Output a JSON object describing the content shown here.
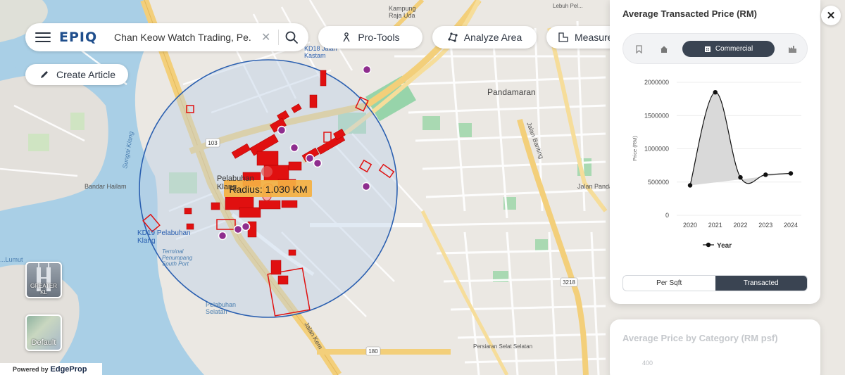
{
  "search": {
    "logo": "EPIQ",
    "query": "Chan Keow Watch Trading, Pe..."
  },
  "toolbar": {
    "protools_label": "Pro-Tools",
    "analyze_label": "Analyze Area",
    "measure_label": "Measure"
  },
  "create_article_label": "Create Article",
  "map": {
    "radius_label": "Radius: 1.030 KM",
    "labels": {
      "kampung_raja_uda": "Kampung\nRaja Uda",
      "lebuh_pelabuhan": "Lebuh Pel...",
      "kd18": "KD18 Jalan\nKastam",
      "pandamaran": "Pandamaran",
      "pelabuhan_klang": "Pelabuhan\nKlang",
      "kd19": "KD19 Pelabuhan\nKlang",
      "terminal": "Terminal\nPenumpang\nSouth Port",
      "pelabuhan_selatan": "Pelabuhan\nSelatan",
      "sungai_klang": "Sungai Klang",
      "jalan_kem": "Jalan Kem",
      "jalan_banting": "Jalan Banting",
      "jalan_pandamaran": "Jalan Panda...",
      "persiaran_selat_selatan": "Persiaran Selat Selatan",
      "bandar_hailam": "Bandar Hailam",
      "lumut": "...Lumut",
      "road_103": "103",
      "road_180": "180",
      "road_3218": "3218"
    }
  },
  "layers": {
    "greater_kl": "GREATER KL",
    "default": "Default"
  },
  "powered_by": {
    "label": "Powered by",
    "brand": "EdgeProp"
  },
  "panel": {
    "title": "Average Transacted Price (RM)",
    "active_category": "Commercial",
    "category_icons": [
      "bookmark-icon",
      "home-icon",
      "building-icon",
      "factory-icon"
    ],
    "toggle_per_sqft": "Per Sqft",
    "toggle_transacted": "Transacted",
    "close_icon": "close-icon"
  },
  "panel2": {
    "title": "Average Price by Category (RM psf)",
    "tick": "400"
  },
  "chart_data": {
    "type": "line",
    "title": "",
    "xlabel": "",
    "ylabel": "Price (RM)",
    "x": [
      "2020",
      "2021",
      "2022",
      "2023",
      "2024"
    ],
    "series": [
      {
        "name": "Year",
        "values": [
          450000,
          1850000,
          570000,
          610000,
          630000
        ]
      }
    ],
    "yticks": [
      0,
      500000,
      1000000,
      1500000,
      2000000
    ],
    "ylim": [
      0,
      2000000
    ],
    "legend": "bottom",
    "line_color": "#111111",
    "fill_color": "#d9d9d9"
  },
  "colors": {
    "accent_dark": "#3a4452",
    "radius_circle": "#2a5fb0",
    "property_red": "#e01010",
    "poi_purple": "#8e2d8e",
    "water": "#a9cfe6",
    "major_road": "#f3cf7a",
    "green_area": "#8ed1a3"
  }
}
